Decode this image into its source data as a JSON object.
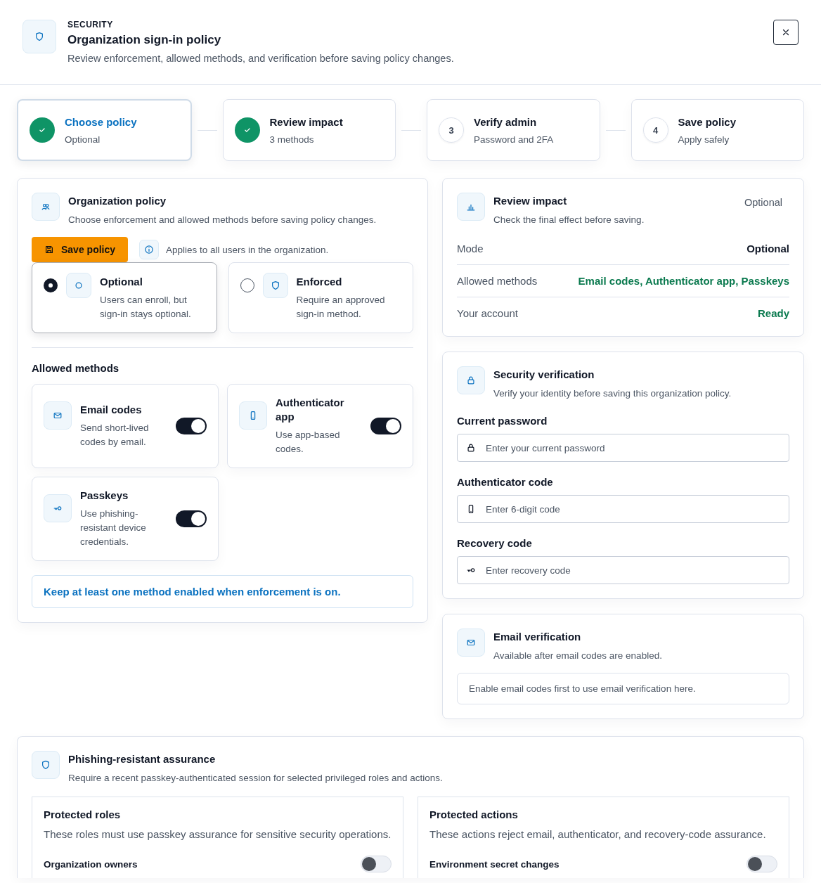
{
  "header": {
    "eyebrow": "SECURITY",
    "title": "Organization sign-in policy",
    "subtitle": "Review enforcement, allowed methods, and verification before saving policy changes."
  },
  "steps": [
    {
      "title": "Choose policy",
      "subtitle": "Optional",
      "completed": true,
      "selected": true
    },
    {
      "title": "Review impact",
      "subtitle": "3 methods",
      "completed": true,
      "selected": false
    },
    {
      "title": "Verify admin",
      "subtitle": "Password and 2FA",
      "completed": false,
      "number": "3",
      "selected": false
    },
    {
      "title": "Save policy",
      "subtitle": "Apply safely",
      "completed": false,
      "number": "4",
      "selected": false
    }
  ],
  "policy": {
    "title": "Organization policy",
    "description": "Choose enforcement and allowed methods before saving policy changes.",
    "save_button": "Save policy",
    "note": "Applies to all users in the organization.",
    "modes": [
      {
        "title": "Optional",
        "description": "Users can enroll, but sign-in stays optional.",
        "selected": true
      },
      {
        "title": "Enforced",
        "description": "Require an approved sign-in method.",
        "selected": false
      }
    ],
    "methods_heading": "Allowed methods",
    "methods": [
      {
        "title": "Email codes",
        "description": "Send short-lived codes by email.",
        "on": true
      },
      {
        "title": "Authenticator app",
        "description": "Use app-based codes.",
        "on": true
      },
      {
        "title": "Passkeys",
        "description": "Use phishing-resistant device credentials.",
        "on": true
      }
    ],
    "warning": "Keep at least one method enabled when enforcement is on."
  },
  "impact": {
    "title": "Review impact",
    "description": "Check the final effect before saving.",
    "badge": "Optional",
    "rows": [
      {
        "label": "Mode",
        "value": "Optional",
        "color": "#111827"
      },
      {
        "label": "Allowed methods",
        "value": "Email codes, Authenticator app, Passkeys",
        "color": "#0b7a4f"
      },
      {
        "label": "Your account",
        "value": "Ready",
        "color": "#0b7a4f"
      }
    ]
  },
  "verification": {
    "title": "Security verification",
    "description": "Verify your identity before saving this organization policy.",
    "fields": [
      {
        "label": "Current password",
        "placeholder": "Enter your current password"
      },
      {
        "label": "Authenticator code",
        "placeholder": "Enter 6-digit code"
      },
      {
        "label": "Recovery code",
        "placeholder": "Enter recovery code"
      }
    ]
  },
  "email_verification": {
    "title": "Email verification",
    "description": "Available after email codes are enabled.",
    "notice": "Enable email codes first to use email verification here."
  },
  "assurance": {
    "title": "Phishing-resistant assurance",
    "description": "Require a recent passkey-authenticated session for selected privileged roles and actions.",
    "panels": [
      {
        "title": "Protected roles",
        "description": "These roles must use passkey assurance for sensitive security operations.",
        "items": [
          {
            "label": "Organization owners",
            "on": false
          }
        ]
      },
      {
        "title": "Protected actions",
        "description": "These actions reject email, authenticator, and recovery-code assurance.",
        "items": [
          {
            "label": "Environment secret changes",
            "on": false
          }
        ]
      }
    ]
  }
}
